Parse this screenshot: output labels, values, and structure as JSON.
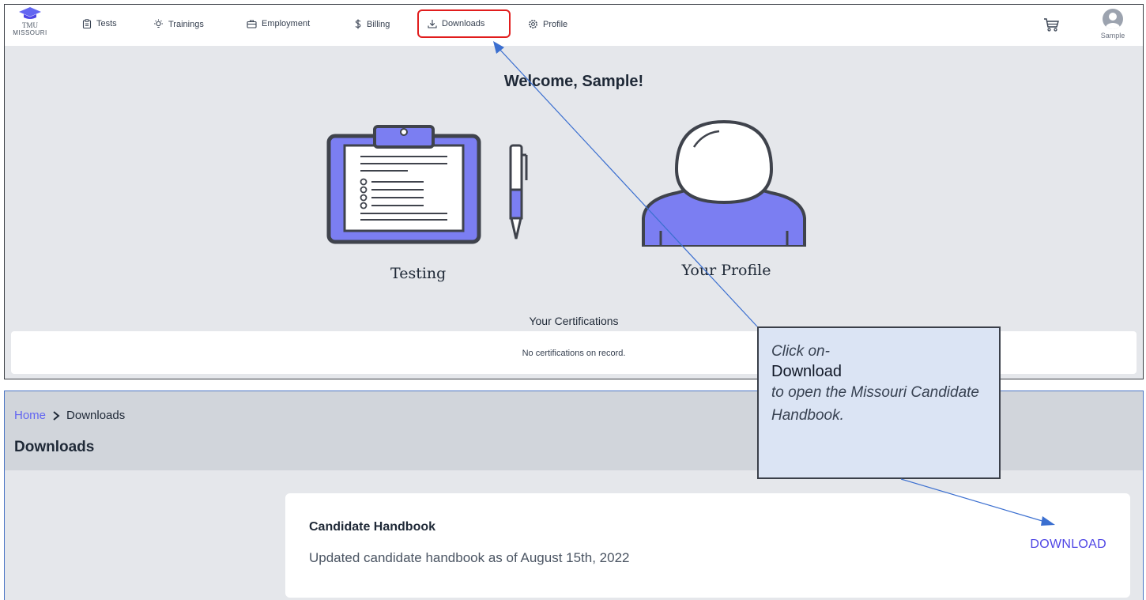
{
  "nav": {
    "logo_line1": "TMU",
    "logo_line2": "MISSOURI",
    "items": [
      {
        "label": "Tests",
        "icon": "clipboard-icon"
      },
      {
        "label": "Trainings",
        "icon": "lightbulb-icon"
      },
      {
        "label": "Employment",
        "icon": "briefcase-icon"
      },
      {
        "label": "Billing",
        "icon": "dollar-icon"
      },
      {
        "label": "Downloads",
        "icon": "download-icon"
      },
      {
        "label": "Profile",
        "icon": "gear-icon"
      }
    ],
    "cart_icon": "cart-icon",
    "user_name": "Sample"
  },
  "dashboard": {
    "welcome": "Welcome, Sample!",
    "tiles": [
      {
        "label": "Testing",
        "icon": "clipboard-pen-illustration"
      },
      {
        "label": "Your Profile",
        "icon": "person-illustration"
      }
    ],
    "certifications_title": "Your Certifications",
    "certifications_empty": "No certifications on record."
  },
  "downloads_page": {
    "breadcrumb": {
      "home": "Home",
      "current": "Downloads"
    },
    "title": "Downloads",
    "items": [
      {
        "title": "Candidate Handbook",
        "description": "Updated candidate handbook as of August 15th, 2022",
        "action": "DOWNLOAD"
      }
    ]
  },
  "annotation": {
    "line1": "Click on-",
    "line2": "Download",
    "line3": "to open the Missouri Candidate Handbook."
  },
  "colors": {
    "accent": "#4f46e5",
    "highlight": "#e11d1d",
    "arrow": "#3b6fd0",
    "illustration": "#7b7ef2"
  }
}
